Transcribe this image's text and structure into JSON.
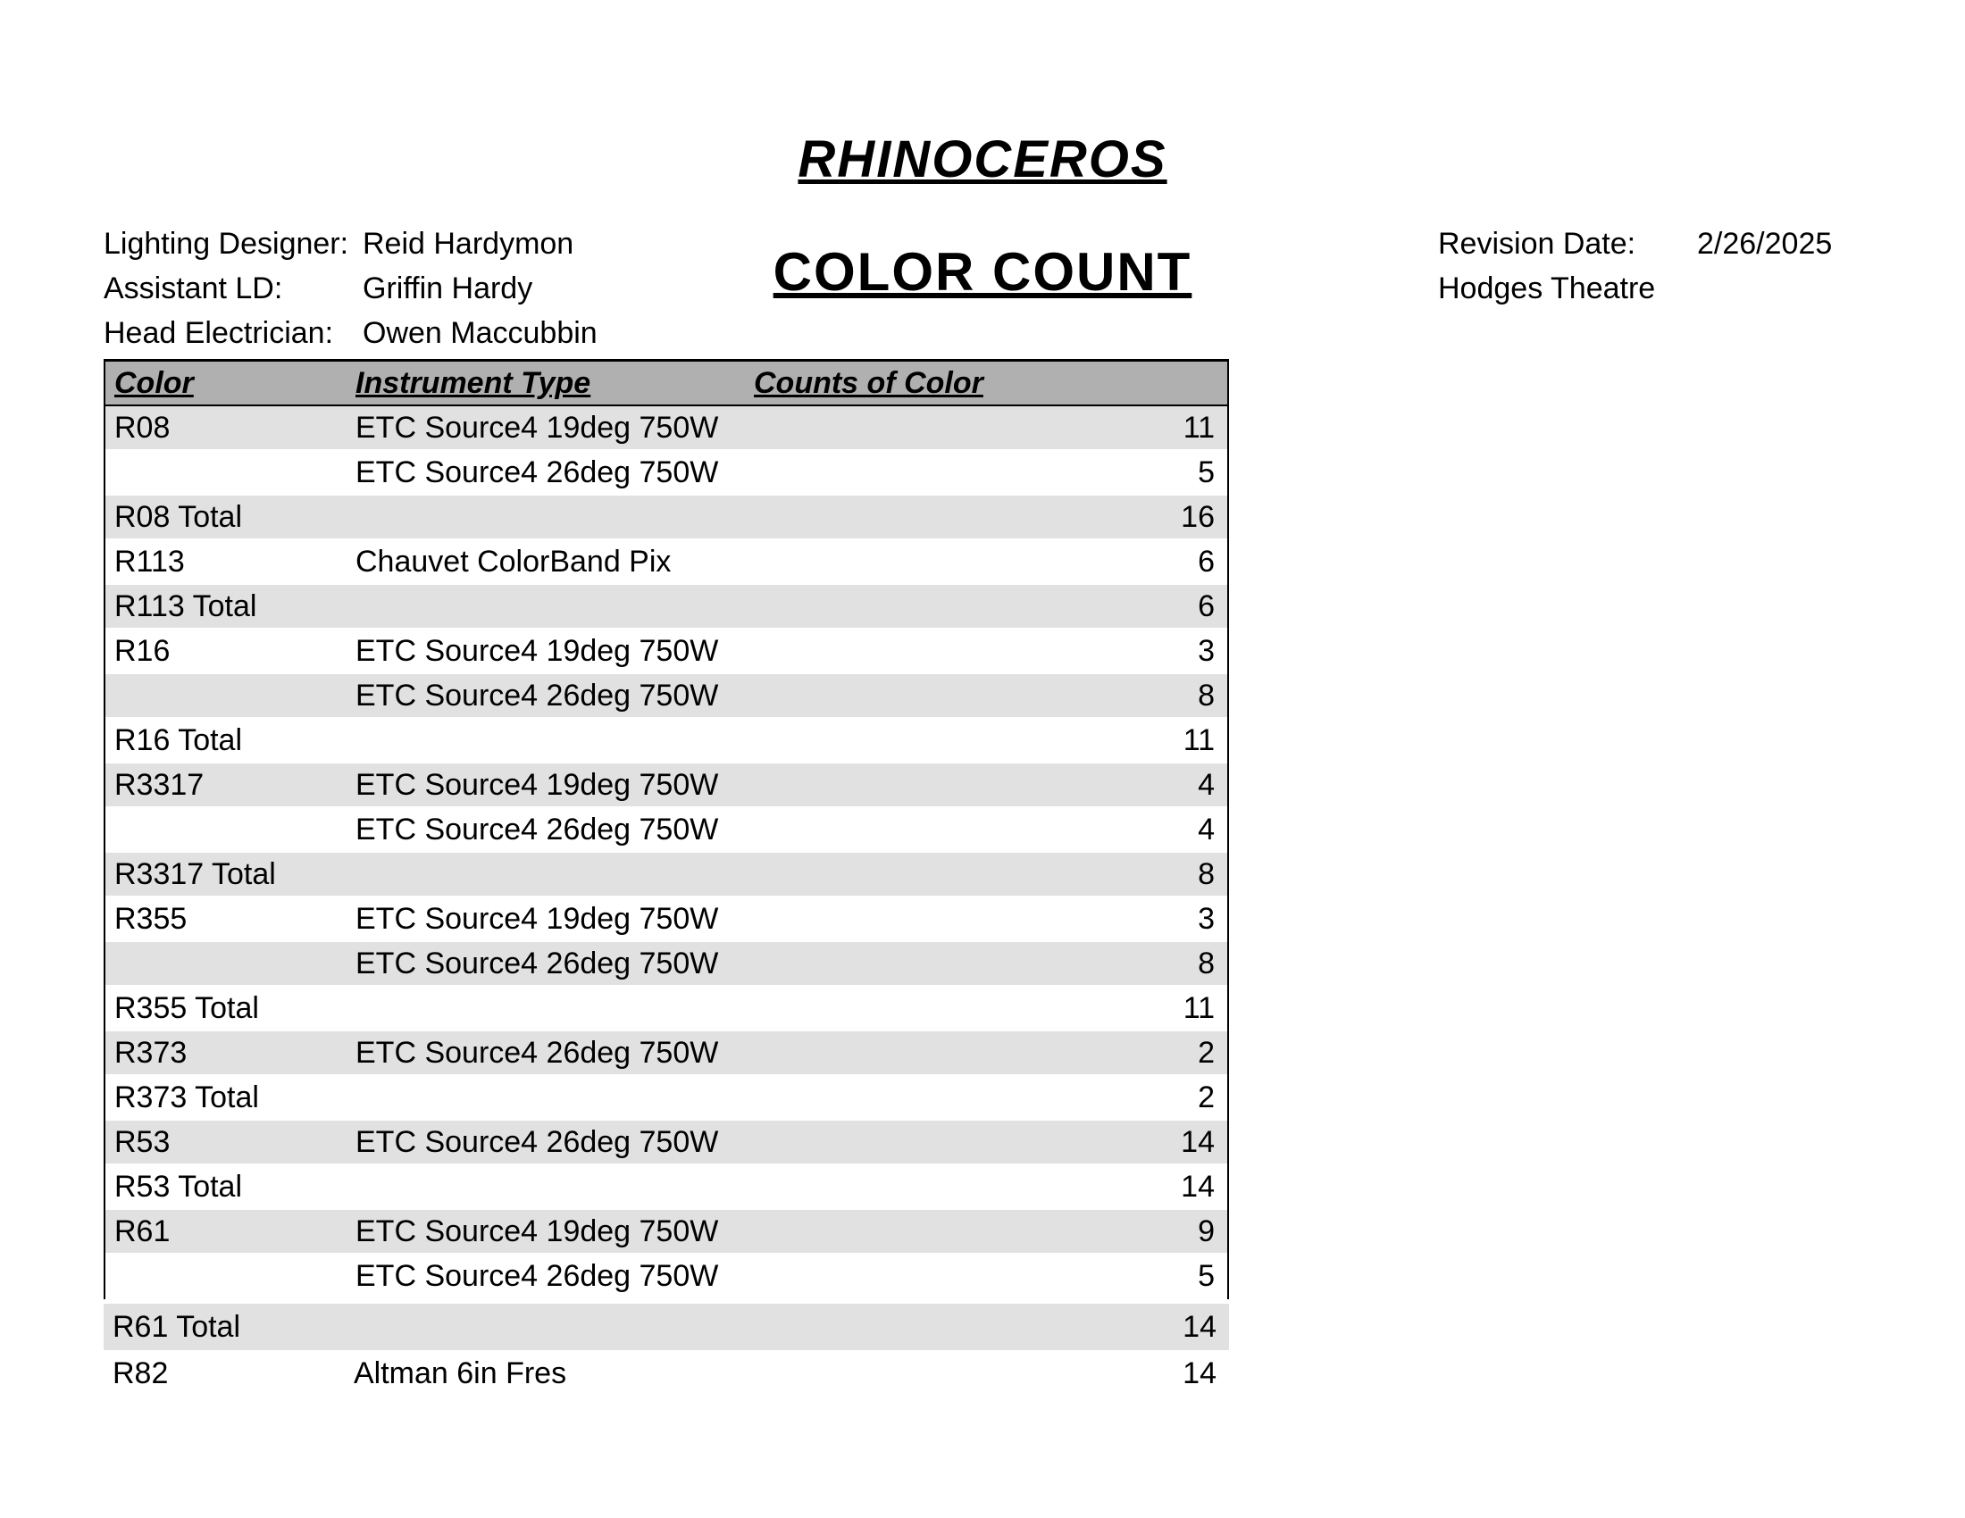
{
  "show_title": "RHINOCEROS",
  "report_title": "COLOR COUNT",
  "credits": {
    "ld_label": "Lighting Designer:",
    "ld_value": "Reid Hardymon",
    "ald_label": "Assistant LD:",
    "ald_value": "Griffin Hardy",
    "he_label": "Head Electrician:",
    "he_value": "Owen Maccubbin"
  },
  "rev": {
    "date_label": "Revision Date:",
    "date_value": "2/26/2025",
    "venue": "Hodges Theatre"
  },
  "headers": {
    "c1": "Color",
    "c2": "Instrument Type",
    "c3": "Counts of Color"
  },
  "rows": [
    {
      "shade": true,
      "c1": "R08",
      "c2": "ETC Source4 19deg 750W",
      "c3": "11"
    },
    {
      "shade": false,
      "c1": "",
      "c2": "ETC Source4 26deg 750W",
      "c3": "5"
    },
    {
      "shade": true,
      "c1": "R08 Total",
      "c2": "",
      "c3": "16"
    },
    {
      "shade": false,
      "c1": "R113",
      "c2": "Chauvet ColorBand Pix",
      "c3": "6"
    },
    {
      "shade": true,
      "c1": "R113 Total",
      "c2": "",
      "c3": "6"
    },
    {
      "shade": false,
      "c1": "R16",
      "c2": "ETC Source4 19deg 750W",
      "c3": "3"
    },
    {
      "shade": true,
      "c1": "",
      "c2": "ETC Source4 26deg 750W",
      "c3": "8"
    },
    {
      "shade": false,
      "c1": "R16 Total",
      "c2": "",
      "c3": "11"
    },
    {
      "shade": true,
      "c1": "R3317",
      "c2": "ETC Source4 19deg 750W",
      "c3": "4"
    },
    {
      "shade": false,
      "c1": "",
      "c2": "ETC Source4 26deg 750W",
      "c3": "4"
    },
    {
      "shade": true,
      "c1": "R3317 Total",
      "c2": "",
      "c3": "8"
    },
    {
      "shade": false,
      "c1": "R355",
      "c2": "ETC Source4 19deg 750W",
      "c3": "3"
    },
    {
      "shade": true,
      "c1": "",
      "c2": "ETC Source4 26deg 750W",
      "c3": "8"
    },
    {
      "shade": false,
      "c1": "R355 Total",
      "c2": "",
      "c3": "11"
    },
    {
      "shade": true,
      "c1": "R373",
      "c2": "ETC Source4 26deg 750W",
      "c3": "2"
    },
    {
      "shade": false,
      "c1": "R373 Total",
      "c2": "",
      "c3": "2"
    },
    {
      "shade": true,
      "c1": "R53",
      "c2": "ETC Source4 26deg 750W",
      "c3": "14"
    },
    {
      "shade": false,
      "c1": "R53 Total",
      "c2": "",
      "c3": "14"
    },
    {
      "shade": true,
      "c1": "R61",
      "c2": "ETC Source4 19deg 750W",
      "c3": "9"
    },
    {
      "shade": false,
      "c1": "",
      "c2": "ETC Source4 26deg 750W",
      "c3": "5"
    }
  ],
  "after_rows": [
    {
      "shade": true,
      "c1": "R61 Total",
      "c2": "",
      "c3": "14"
    },
    {
      "shade": false,
      "c1": "R82",
      "c2": "Altman 6in Fres",
      "c3": "14"
    }
  ]
}
